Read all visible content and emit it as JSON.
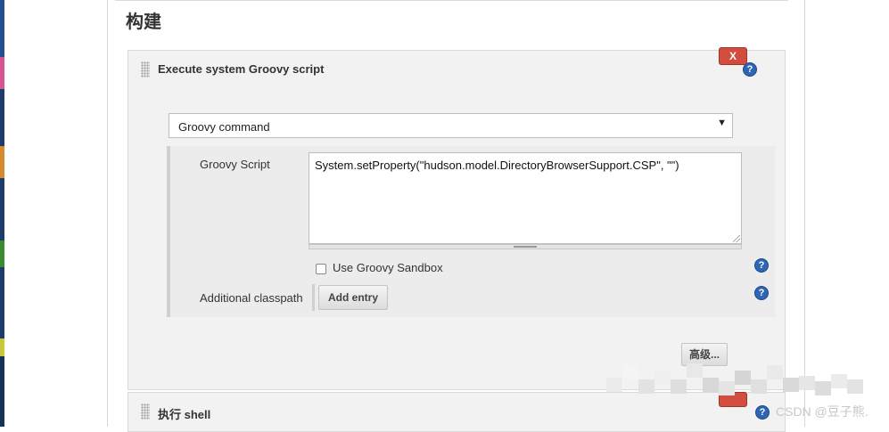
{
  "section": {
    "title": "构建"
  },
  "step1": {
    "title": "Execute system Groovy script",
    "delete_label": "X",
    "help_label": "?",
    "select": {
      "value": "Groovy command",
      "arrow": "▼"
    },
    "script_label": "Groovy Script",
    "script_value": "System.setProperty(\"hudson.model.DirectoryBrowserSupport.CSP\", \"\")",
    "sandbox_label": "Use Groovy Sandbox",
    "sandbox_checked": false,
    "classpath_label": "Additional classpath",
    "add_entry_label": "Add entry",
    "advanced_label": "高级..."
  },
  "step2": {
    "title": "执行 shell",
    "help_label": "?"
  },
  "watermark": "CSDN @豆子熊.",
  "colors": {
    "delete_red": "#d24c3f",
    "help_blue": "#2e66b3",
    "panel_gray": "#f2f2f2"
  }
}
